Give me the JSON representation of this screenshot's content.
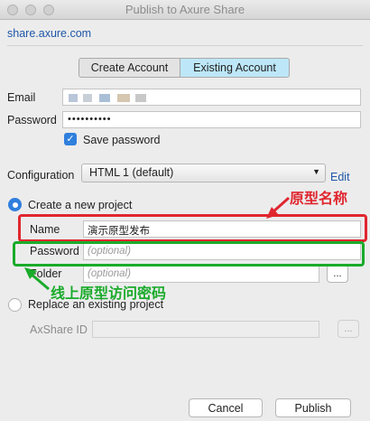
{
  "window": {
    "title": "Publish to Axure Share"
  },
  "server_url": "share.axure.com",
  "tabs": {
    "create": "Create Account",
    "existing": "Existing Account"
  },
  "account": {
    "email_label": "Email",
    "password_label": "Password",
    "password_value": "••••••••••",
    "save_password_label": "Save password"
  },
  "configuration": {
    "label": "Configuration",
    "selected": "HTML 1 (default)",
    "edit_label": "Edit"
  },
  "new_project": {
    "radio_label": "Create a new project",
    "name_label": "Name",
    "name_value": "演示原型发布",
    "password_label": "Password",
    "password_placeholder": "(optional)",
    "folder_label": "Folder",
    "folder_placeholder": "(optional)",
    "browse_label": "..."
  },
  "existing_project": {
    "radio_label": "Replace an existing project",
    "id_label": "AxShare ID",
    "browse_label": "..."
  },
  "buttons": {
    "cancel": "Cancel",
    "publish": "Publish"
  },
  "annotations": {
    "name_note": "原型名称",
    "password_note": "线上原型访问密码"
  },
  "colors": {
    "accent": "#2f7fdd",
    "link": "#1f57a8",
    "annotation_red": "#e0262f",
    "annotation_green": "#1aab2b",
    "selected_tab": "#bde7f8"
  }
}
